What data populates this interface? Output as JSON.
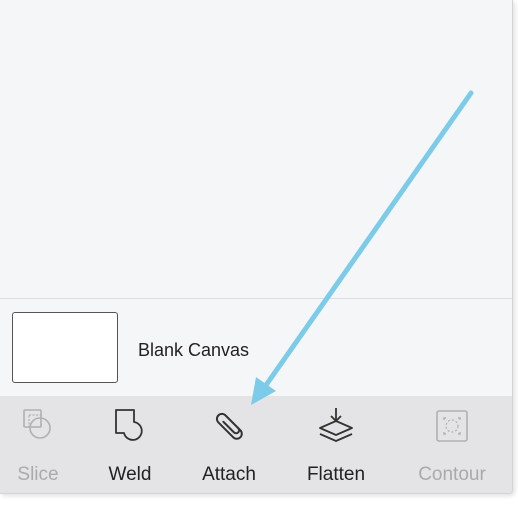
{
  "canvas": {
    "label": "Blank Canvas"
  },
  "toolbar": {
    "tools": [
      {
        "label": "Slice",
        "icon": "slice-icon",
        "enabled": false
      },
      {
        "label": "Weld",
        "icon": "weld-icon",
        "enabled": true
      },
      {
        "label": "Attach",
        "icon": "paperclip-icon",
        "enabled": true
      },
      {
        "label": "Flatten",
        "icon": "flatten-icon",
        "enabled": true
      },
      {
        "label": "Contour",
        "icon": "contour-icon",
        "enabled": false
      }
    ]
  },
  "annotation": {
    "type": "arrow",
    "color": "#7ccbe9",
    "points_to": "Attach"
  },
  "colors": {
    "panel_bg": "#f5f6f8",
    "toolbar_bg": "#e4e4e6",
    "disabled_text": "#aaaaaa",
    "enabled_text": "#222222"
  }
}
